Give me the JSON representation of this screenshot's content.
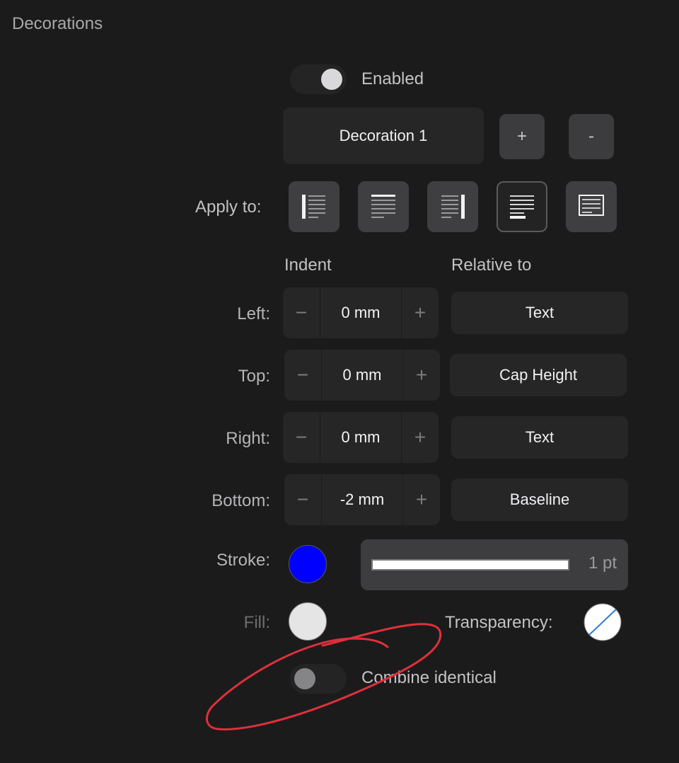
{
  "section": {
    "title": "Decorations"
  },
  "enabled": {
    "label": "Enabled",
    "on": true
  },
  "decoration": {
    "name": "Decoration 1",
    "add_label": "+",
    "remove_label": "-"
  },
  "apply_to": {
    "label": "Apply to:",
    "options": [
      {
        "icon": "left-border-icon"
      },
      {
        "icon": "paragraph-lines-icon"
      },
      {
        "icon": "right-border-icon"
      },
      {
        "icon": "bottom-border-icon",
        "selected": true
      },
      {
        "icon": "box-border-icon"
      }
    ]
  },
  "indent": {
    "header": "Indent",
    "relative_header": "Relative to",
    "rows": [
      {
        "label": "Left:",
        "value": "0 mm",
        "relative": "Text"
      },
      {
        "label": "Top:",
        "value": "0 mm",
        "relative": "Cap Height"
      },
      {
        "label": "Right:",
        "value": "0 mm",
        "relative": "Text"
      },
      {
        "label": "Bottom:",
        "value": "-2 mm",
        "relative": "Baseline"
      }
    ],
    "minus": "−",
    "plus": "+"
  },
  "stroke": {
    "label": "Stroke:",
    "color": "#0000ff",
    "width": "1 pt"
  },
  "fill": {
    "label": "Fill:",
    "color": "#e5e5e5"
  },
  "transparency": {
    "label": "Transparency:"
  },
  "combine": {
    "label": "Combine identical",
    "on": false
  },
  "colors": {
    "background": "#1b1b1c",
    "annotation": "#e0303c"
  }
}
